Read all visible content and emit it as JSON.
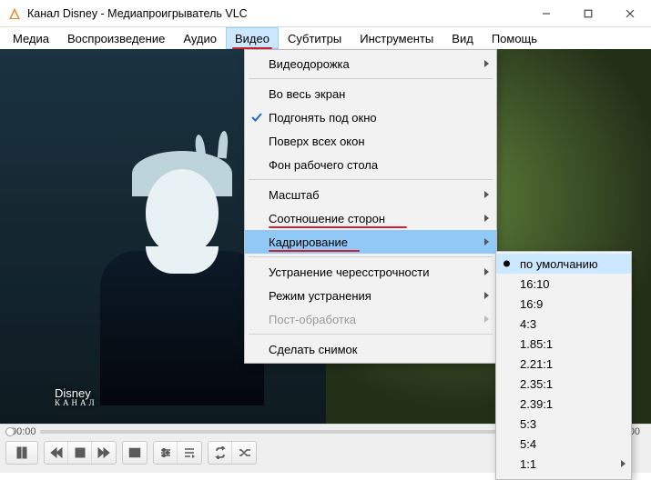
{
  "window": {
    "title": "Канал Disney - Медиапроигрыватель VLC"
  },
  "menubar": {
    "items": [
      {
        "label": "Медиа"
      },
      {
        "label": "Воспроизведение"
      },
      {
        "label": "Аудио"
      },
      {
        "label": "Видео",
        "open": true
      },
      {
        "label": "Субтитры"
      },
      {
        "label": "Инструменты"
      },
      {
        "label": "Вид"
      },
      {
        "label": "Помощь"
      }
    ]
  },
  "video_menu": {
    "items": [
      {
        "label": "Видеодорожка",
        "submenu": true
      },
      {
        "sep": true
      },
      {
        "label": "Во весь экран"
      },
      {
        "label": "Подгонять под окно",
        "checked": true
      },
      {
        "label": "Поверх всех окон"
      },
      {
        "label": "Фон рабочего стола"
      },
      {
        "sep": true
      },
      {
        "label": "Масштаб",
        "submenu": true
      },
      {
        "label": "Соотношение сторон",
        "submenu": true,
        "underline": 174
      },
      {
        "label": "Кадрирование",
        "submenu": true,
        "hover": true,
        "underline": 122
      },
      {
        "sep": true
      },
      {
        "label": "Устранение чересстрочности",
        "submenu": true
      },
      {
        "label": "Режим устранения",
        "submenu": true
      },
      {
        "label": "Пост-обработка",
        "submenu": true,
        "disabled": true
      },
      {
        "sep": true
      },
      {
        "label": "Сделать снимок"
      }
    ]
  },
  "crop_submenu": {
    "items": [
      {
        "label": "по умолчанию",
        "selected": true
      },
      {
        "label": "16:10"
      },
      {
        "label": "16:9"
      },
      {
        "label": "4:3"
      },
      {
        "label": "1.85:1"
      },
      {
        "label": "2.21:1"
      },
      {
        "label": "2.35:1"
      },
      {
        "label": "2.39:1"
      },
      {
        "label": "5:3"
      },
      {
        "label": "5:4"
      },
      {
        "label": "1:1"
      }
    ]
  },
  "playback": {
    "elapsed": "00:00",
    "duration": "00:00"
  },
  "video_overlay": {
    "logo": "Disney",
    "logo_sub": "КАНАЛ"
  }
}
